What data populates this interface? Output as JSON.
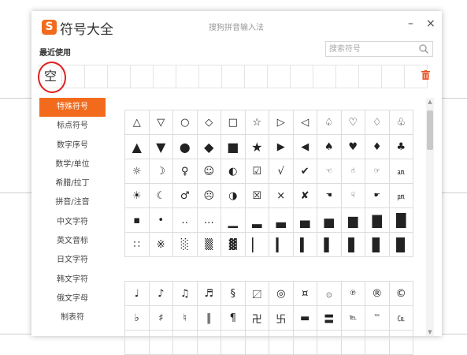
{
  "window": {
    "app_title": "符号大全",
    "caption": "搜狗拼音输入法",
    "logo_letter": "S",
    "minimize": "–",
    "close": "×"
  },
  "recent": {
    "label": "最近使用",
    "items": [
      "空",
      "",
      "",
      "",
      "",
      "",
      "",
      "",
      "",
      "",
      "",
      "",
      "",
      "",
      "",
      "",
      ""
    ]
  },
  "search": {
    "placeholder": "搜索符号",
    "value": ""
  },
  "sidebar": {
    "items": [
      {
        "label": "特殊符号",
        "active": true
      },
      {
        "label": "标点符号",
        "active": false
      },
      {
        "label": "数字序号",
        "active": false
      },
      {
        "label": "数学/单位",
        "active": false
      },
      {
        "label": "希腊/拉丁",
        "active": false
      },
      {
        "label": "拼音/注音",
        "active": false
      },
      {
        "label": "中文字符",
        "active": false
      },
      {
        "label": "英文音标",
        "active": false
      },
      {
        "label": "日文字符",
        "active": false
      },
      {
        "label": "韩文字符",
        "active": false
      },
      {
        "label": "俄文字母",
        "active": false
      },
      {
        "label": "制表符",
        "active": false
      }
    ]
  },
  "symbols_section1": [
    "△",
    "▽",
    "○",
    "◇",
    "□",
    "☆",
    "▷",
    "◁",
    "♤",
    "♡",
    "♢",
    "♧",
    "▲",
    "▼",
    "●",
    "◆",
    "■",
    "★",
    "▶",
    "◀",
    "♠",
    "♥",
    "♦",
    "♣",
    "☼",
    "☽",
    "♀",
    "☺",
    "◐",
    "☑",
    "√",
    "✔",
    "☜",
    "☝",
    "☞",
    "㏂",
    "☀",
    "☾",
    "♂",
    "☹",
    "◑",
    "☒",
    "×",
    "✘",
    "☚",
    "☟",
    "☛",
    "㏘",
    "▪",
    "•",
    "‥",
    "…",
    "▁",
    "▂",
    "▃",
    "▄",
    "▅",
    "▆",
    "▇",
    "█",
    "∷",
    "※",
    "░",
    "▒",
    "▓",
    "▏",
    "▎",
    "▍",
    "▌",
    "▋",
    "▊",
    "▉"
  ],
  "symbols_section2": [
    "♩",
    "♪",
    "♫",
    "♬",
    "§",
    "〼",
    "◎",
    "¤",
    "۞",
    "℗",
    "®",
    "©",
    "♭",
    "♯",
    "♮",
    "‖",
    "¶",
    "卍",
    "卐",
    "▬",
    "〓",
    "℡",
    "™",
    "㏇",
    "",
    "",
    "",
    "",
    "",
    "",
    "",
    "",
    "",
    "",
    "",
    ""
  ],
  "colors": {
    "accent": "#f26b1d",
    "highlight": "#e02020"
  }
}
